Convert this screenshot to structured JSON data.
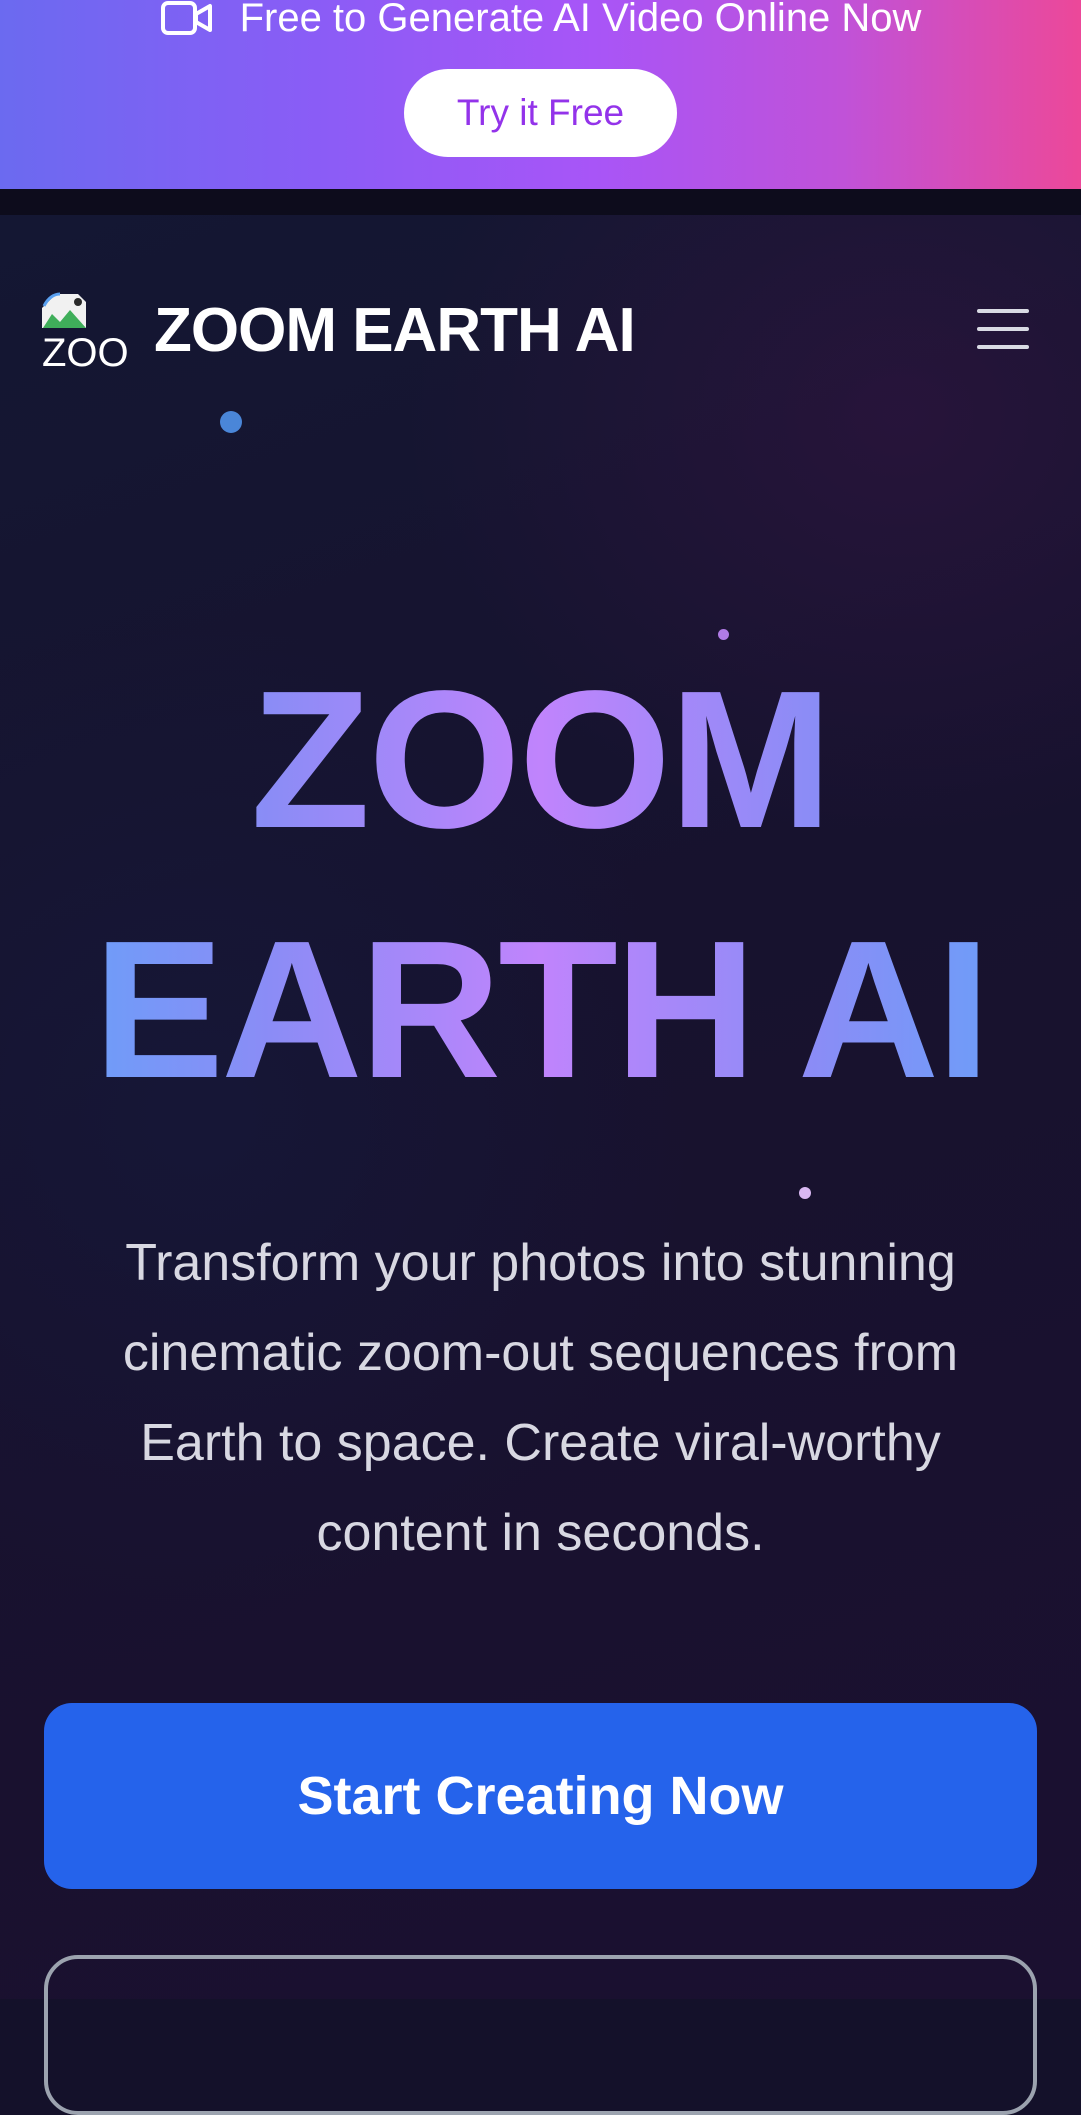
{
  "promo_banner": {
    "icon": "video-camera-icon",
    "text": "Free to Generate AI Video Online Now",
    "button_label": "Try it Free"
  },
  "header": {
    "logo_alt": "ZOOM EARTH AI",
    "logo_icon": "broken-image-icon",
    "brand": "ZOOM EARTH AI",
    "menu_icon": "hamburger-menu-icon"
  },
  "hero": {
    "title_line1": "ZOOM",
    "title_line2": "EARTH AI",
    "subtitle": "Transform your photos into stunning cinematic zoom-out sequences from Earth to space. Create viral-worthy content in seconds.",
    "primary_cta": "Start Creating Now"
  },
  "colors": {
    "promo_gradient": [
      "#6b6af0",
      "#a855f7",
      "#ec4899"
    ],
    "background": "#14112a",
    "primary_button": "#2563eb",
    "title_gradient": [
      "#60a5fa",
      "#c084fc"
    ]
  }
}
